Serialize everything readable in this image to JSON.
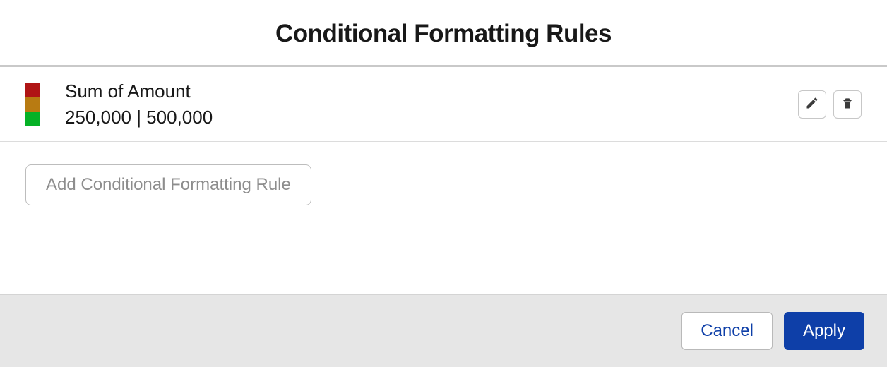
{
  "title": "Conditional Formatting Rules",
  "rules": [
    {
      "field": "Sum of Amount",
      "thresholds_display": "250,000 | 500,000",
      "colors": {
        "high": "#b01515",
        "mid": "#b87b12",
        "low": "#05b126"
      }
    }
  ],
  "add_button_label": "Add Conditional Formatting Rule",
  "footer": {
    "cancel_label": "Cancel",
    "apply_label": "Apply"
  }
}
